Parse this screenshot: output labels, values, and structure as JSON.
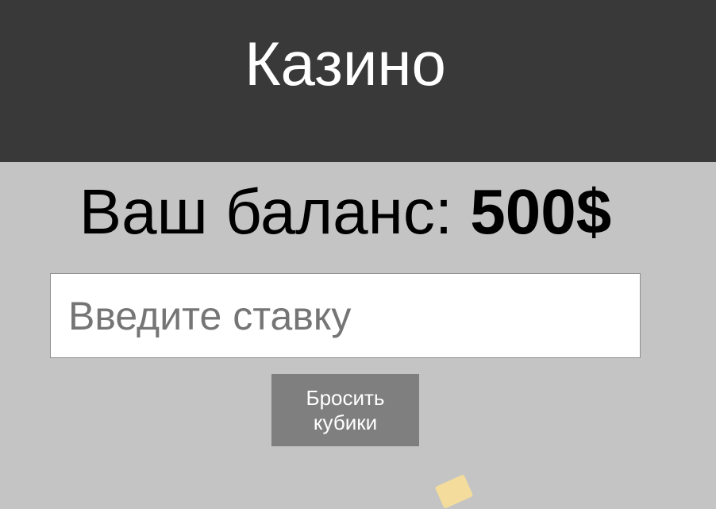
{
  "header": {
    "title": "Казино"
  },
  "balance": {
    "label": "Ваш баланс: ",
    "amount": "500$"
  },
  "bet": {
    "value": "",
    "placeholder": "Введите ставку"
  },
  "roll_button": {
    "label": "Бросить кубики"
  },
  "colors": {
    "header_bg": "#393939",
    "page_bg": "#c4c4c4",
    "button_bg": "#7f7f7f"
  },
  "icons": {
    "dice": "dice-icon"
  }
}
